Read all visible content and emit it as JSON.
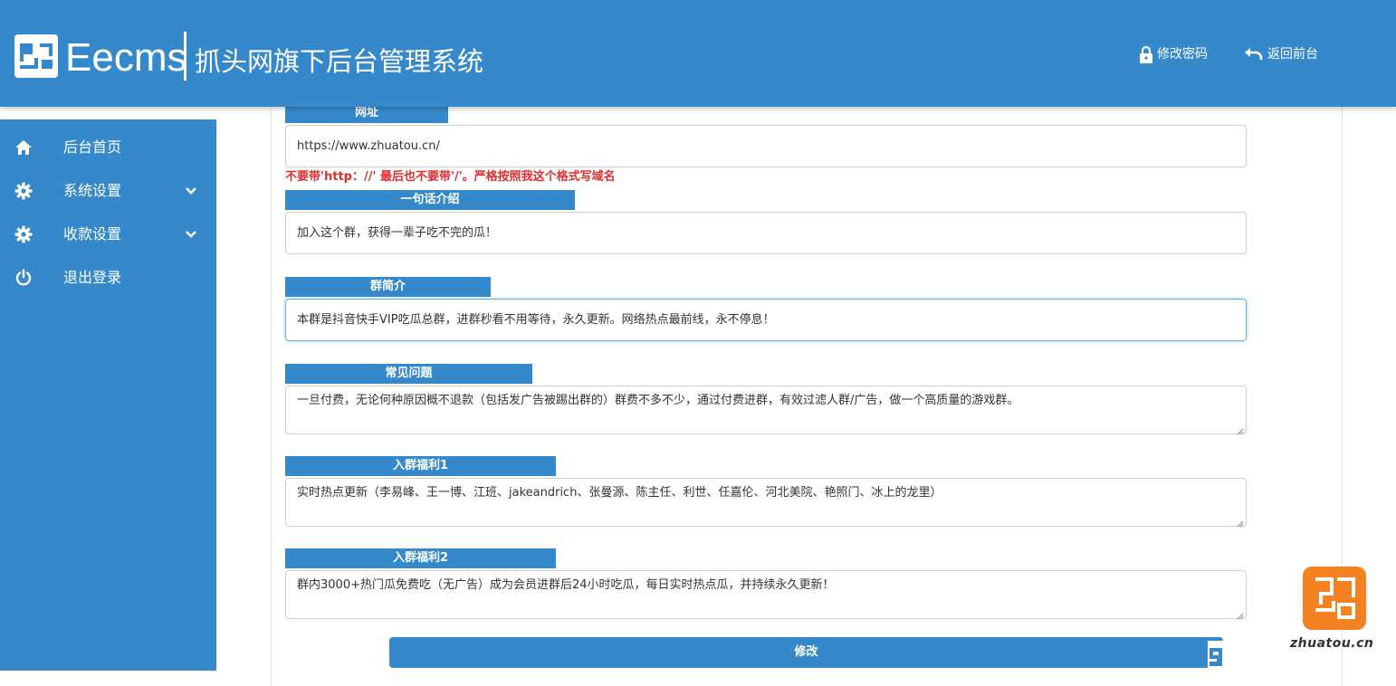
{
  "header": {
    "brand": "Eecms",
    "subtitle": "抓头网旗下后台管理系统",
    "change_password": "修改密码",
    "back_to_front": "返回前台"
  },
  "sidebar": {
    "items": [
      {
        "label": "后台首页",
        "icon": "home-icon",
        "has_submenu": false
      },
      {
        "label": "系统设置",
        "icon": "gear-icon",
        "has_submenu": true
      },
      {
        "label": "收款设置",
        "icon": "gear-icon",
        "has_submenu": true
      },
      {
        "label": "退出登录",
        "icon": "power-icon",
        "has_submenu": false
      }
    ]
  },
  "form": {
    "url": {
      "label": "网址",
      "value": "https://www.zhuatou.cn/",
      "hint": "不要带'http：//' 最后也不要带'/'。严格按照我这个格式写域名"
    },
    "intro": {
      "label": "一句话介绍",
      "value": "加入这个群，获得一辈子吃不完的瓜！"
    },
    "group_desc": {
      "label": "群简介",
      "value": "本群是抖音快手VIP吃瓜总群，进群秒看不用等待，永久更新。网络热点最前线，永不停息！"
    },
    "faq": {
      "label": "常见问题",
      "value": "一旦付费，无论何种原因概不退款（包括发广告被踢出群的）群费不多不少，通过付费进群，有效过滤人群/广告，做一个高质量的游戏群。"
    },
    "benefit1": {
      "label": "入群福利1",
      "value": "实时热点更新（李易峰、王一博、江班、jakeandrich、张曼源、陈主任、利世、任嘉伦、河北美院、艳照门、冰上的龙里）"
    },
    "benefit2": {
      "label": "入群福利2",
      "value": "群内3000+热门瓜免费吃（无广告）成为会员进群后24小时吃瓜，每日实时热点瓜，并持续永久更新！"
    },
    "submit_label": "修改"
  },
  "watermark": {
    "text": "zhuatou.cn"
  },
  "colors": {
    "primary": "#3589cb",
    "hint": "#e12d2d",
    "watermark": "#f58220"
  }
}
